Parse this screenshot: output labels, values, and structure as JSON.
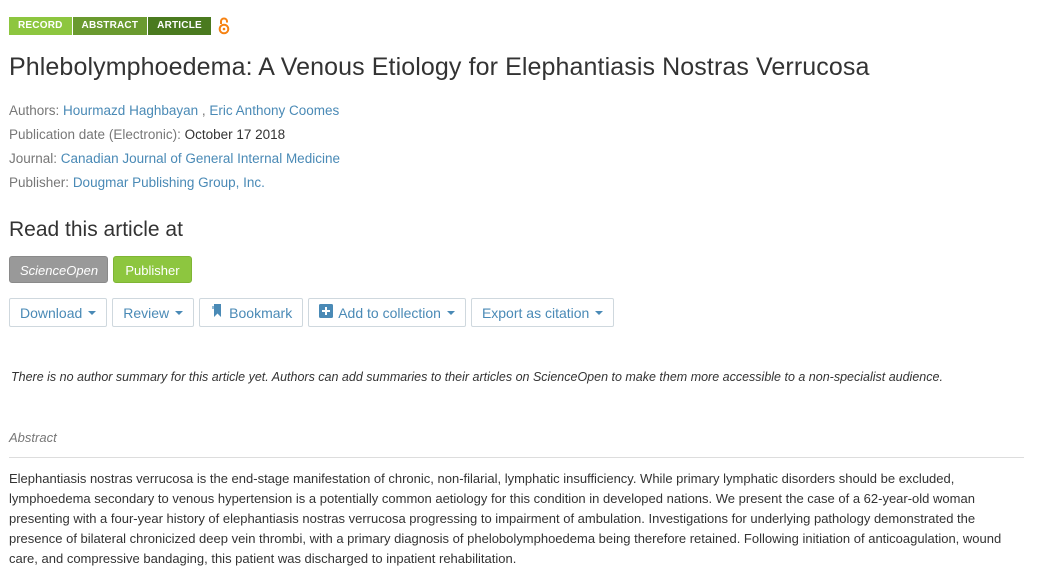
{
  "badges": {
    "record": "RECORD",
    "abstract": "ABSTRACT",
    "article": "ARTICLE"
  },
  "title": "Phlebolymphoedema: A Venous Etiology for Elephantiasis Nostras Verrucosa",
  "meta": {
    "authors_label": "Authors:",
    "author_1": "Hourmazd Haghbayan",
    "author_sep": " ,",
    "author_2": "Eric Anthony Coomes",
    "date_label": "Publication date (Electronic):",
    "date_value": "October 17 2018",
    "journal_label": "Journal:",
    "journal_value": "Canadian Journal of General Internal Medicine",
    "publisher_label": "Publisher:",
    "publisher_value": "Dougmar Publishing Group, Inc."
  },
  "read_heading": "Read this article at",
  "sources": {
    "scienceopen": "ScienceOpen",
    "publisher": "Publisher"
  },
  "actions": {
    "download": "Download",
    "review": "Review",
    "bookmark": "Bookmark",
    "add_to_collection": "Add to collection",
    "export": "Export as citation"
  },
  "summary_note": "There is no author summary for this article yet. Authors can add summaries to their articles on ScienceOpen to make them more accessible to a non-specialist audience.",
  "abstract_label": "Abstract",
  "abstract_text": "Elephantiasis nostras verrucosa is the end-stage manifestation of chronic, non-filarial, lymphatic insufficiency. While primary lymphatic disorders should be excluded, lymphoedema secondary to venous hypertension is a potentially common aetiology for this condition in developed nations. We present the case of a 62-year-old woman presenting with a four-year history of elephantiasis nostras verrucosa progressing to impairment of ambulation. Investigations for underlying pathology demonstrated the presence of bilateral chronicized deep vein thrombi, with a primary diagnosis of phelobolymphoedema being therefore retained. Following initiation of anticoagulation, wound care, and compressive bandaging, this patient was discharged to inpatient rehabilitation.",
  "colors": {
    "green": "#8dc63f",
    "link": "#4a8ab6",
    "open_access": "#f68212"
  }
}
